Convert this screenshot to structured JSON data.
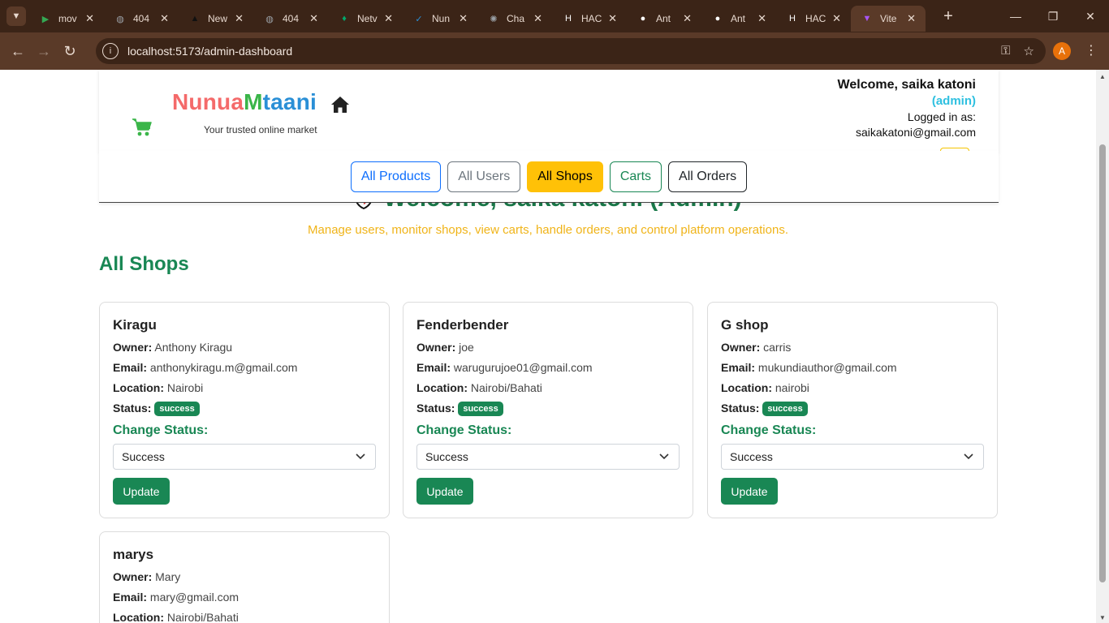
{
  "browser": {
    "tabs": [
      {
        "label": "mov",
        "icon": "play-icon",
        "color": "#34a853"
      },
      {
        "label": "404",
        "icon": "globe-icon",
        "color": "#9aa0a6"
      },
      {
        "label": "New",
        "icon": "triangle-icon",
        "color": "#111111"
      },
      {
        "label": "404",
        "icon": "globe-icon",
        "color": "#9aa0a6"
      },
      {
        "label": "Netv",
        "icon": "leaf-icon",
        "color": "#00a86b"
      },
      {
        "label": "Nun",
        "icon": "check-icon",
        "color": "#2a8fd6"
      },
      {
        "label": "Cha",
        "icon": "openai-icon",
        "color": "#9aa0a6"
      },
      {
        "label": "HAC",
        "icon": "h-icon",
        "color": "#ffffff"
      },
      {
        "label": "Ant",
        "icon": "github-icon",
        "color": "#ffffff"
      },
      {
        "label": "Ant",
        "icon": "github-icon",
        "color": "#ffffff"
      },
      {
        "label": "HAC",
        "icon": "h-icon",
        "color": "#ffffff"
      },
      {
        "label": "Vite",
        "icon": "vite-icon",
        "color": "#a855f7",
        "active": true
      }
    ],
    "url": "localhost:5173/admin-dashboard",
    "profile_initial": "A"
  },
  "header": {
    "brand_part1": "Nunua",
    "brand_part2": "M",
    "brand_part3": "taani",
    "tagline": "Your trusted online market",
    "welcome": "Welcome, saika katoni",
    "role": "(admin)",
    "logged_in_label": "Logged in as:",
    "email": "saikakatoni@gmail.com"
  },
  "nav": {
    "products": "All Products",
    "users": "All Users",
    "shops": "All Shops",
    "carts": "Carts",
    "orders": "All Orders"
  },
  "hero": {
    "title": "Welcome, saika katoni (Admin)",
    "subtitle": "Manage users, monitor shops, view carts, handle orders, and control platform operations."
  },
  "section_title": "All Shops",
  "labels": {
    "owner": "Owner:",
    "email": "Email:",
    "location": "Location:",
    "status": "Status:",
    "change_status": "Change Status:",
    "update": "Update"
  },
  "shops": [
    {
      "name": "Kiragu",
      "owner": "Anthony Kiragu",
      "email": "anthonykiragu.m@gmail.com",
      "location": "Nairobi",
      "status": "success",
      "selected": "Success"
    },
    {
      "name": "Fenderbender",
      "owner": "joe",
      "email": "warugurujoe01@gmail.com",
      "location": "Nairobi/Bahati",
      "status": "success",
      "selected": "Success"
    },
    {
      "name": "G shop",
      "owner": "carris",
      "email": "mukundiauthor@gmail.com",
      "location": "nairobi",
      "status": "success",
      "selected": "Success"
    },
    {
      "name": "marys",
      "owner": "Mary",
      "email": "mary@gmail.com",
      "location": "Nairobi/Bahati"
    }
  ],
  "colors": {
    "primary_green": "#198754",
    "accent_yellow": "#ffc107",
    "brand_red": "#f46a6a",
    "brand_green": "#3ab549",
    "brand_blue": "#2a8fd6"
  }
}
